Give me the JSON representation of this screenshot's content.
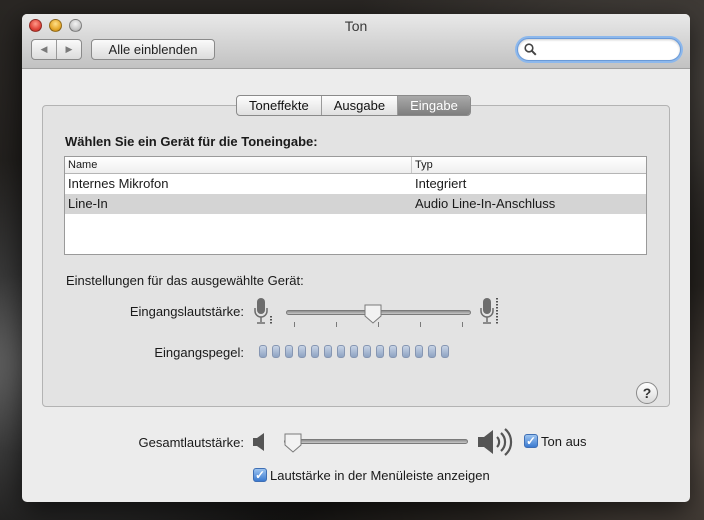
{
  "window": {
    "title": "Ton",
    "show_all_label": "Alle einblenden",
    "search_placeholder": ""
  },
  "tabs": [
    {
      "label": "Toneffekte",
      "active": false
    },
    {
      "label": "Ausgabe",
      "active": false
    },
    {
      "label": "Eingabe",
      "active": true
    }
  ],
  "input": {
    "heading": "Wählen Sie ein Gerät für die Toneingabe:",
    "columns": {
      "name": "Name",
      "type": "Typ"
    },
    "devices": [
      {
        "name": "Internes Mikrofon",
        "type": "Integriert",
        "selected": false
      },
      {
        "name": "Line-In",
        "type": "Audio Line-In-Anschluss",
        "selected": true
      }
    ],
    "settings_label": "Einstellungen für das ausgewählte Gerät:",
    "input_volume_label": "Eingangslautstärke:",
    "input_volume": 0.47,
    "input_level_label": "Eingangspegel:",
    "input_level_segments": 15,
    "input_level_active": 0
  },
  "output": {
    "volume_label": "Gesamtlautstärke:",
    "volume": 0.0,
    "mute_label": "Ton aus",
    "mute_checked": true,
    "menubar_label": "Lautstärke in der Menüleiste anzeigen",
    "menubar_checked": true
  },
  "colors": {
    "accent": "#3b7ad0",
    "active_tab": "#8a8a8a"
  }
}
